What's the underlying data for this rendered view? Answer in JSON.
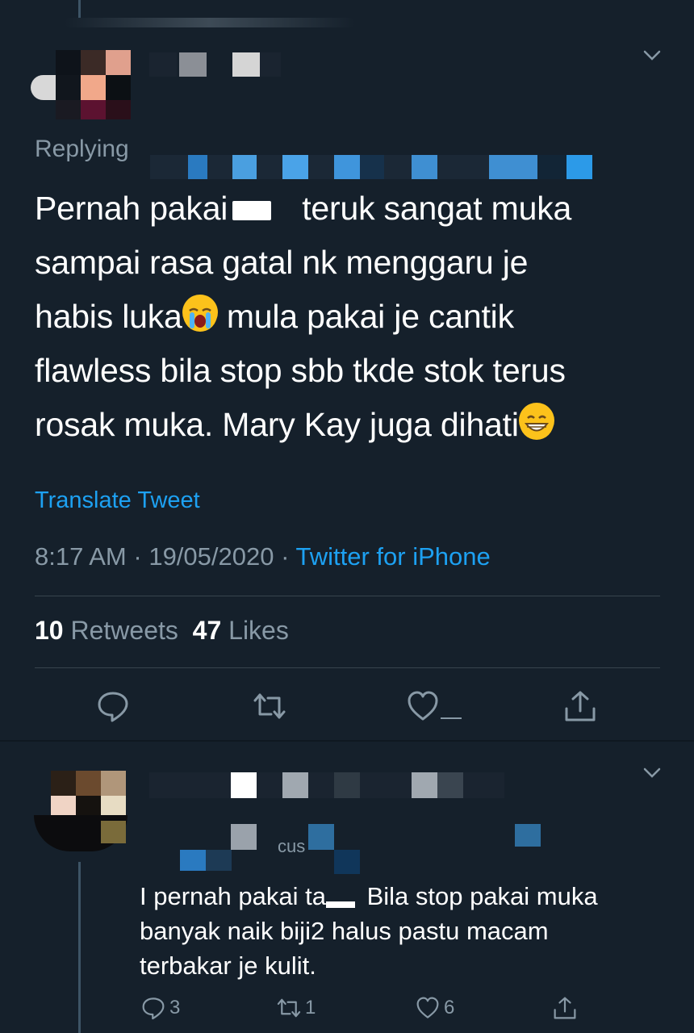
{
  "tweet": {
    "replying_label": "Replying",
    "text_part1": "Pernah pakai",
    "text_part2": "teruk sangat muka\nsampai rasa gatal nk menggaru je\nhabis luka",
    "text_part3": " mula pakai je cantik\nflawless bila stop sbb tkde stok terus\nrosak muka. Mary Kay juga dihati",
    "emoji_crying": "loudly-crying-face-emoji",
    "emoji_grin": "grinning-face-emoji",
    "translate_label": "Translate Tweet",
    "time": "8:17 AM",
    "separator": "·",
    "date": "19/05/2020",
    "source": "Twitter for iPhone",
    "retweets_count": "10",
    "retweets_label": "Retweets",
    "likes_count": "47",
    "likes_label": "Likes",
    "actions": [
      "reply-icon",
      "retweet-icon",
      "like-icon",
      "share-icon"
    ]
  },
  "reply": {
    "handle_fragment": "cus",
    "text_part1": "I pernah pakai ta",
    "text_part2": " Bila stop pakai muka\nbanyak naik biji2 halus pastu macam\nterbakar je kulit.",
    "reply_count": "3",
    "retweet_count": "1",
    "like_count": "6"
  },
  "colors": {
    "background": "#15202b",
    "text": "#ffffff",
    "secondary": "#8899a6",
    "accent": "#1da1f2",
    "divider": "#38444d"
  }
}
